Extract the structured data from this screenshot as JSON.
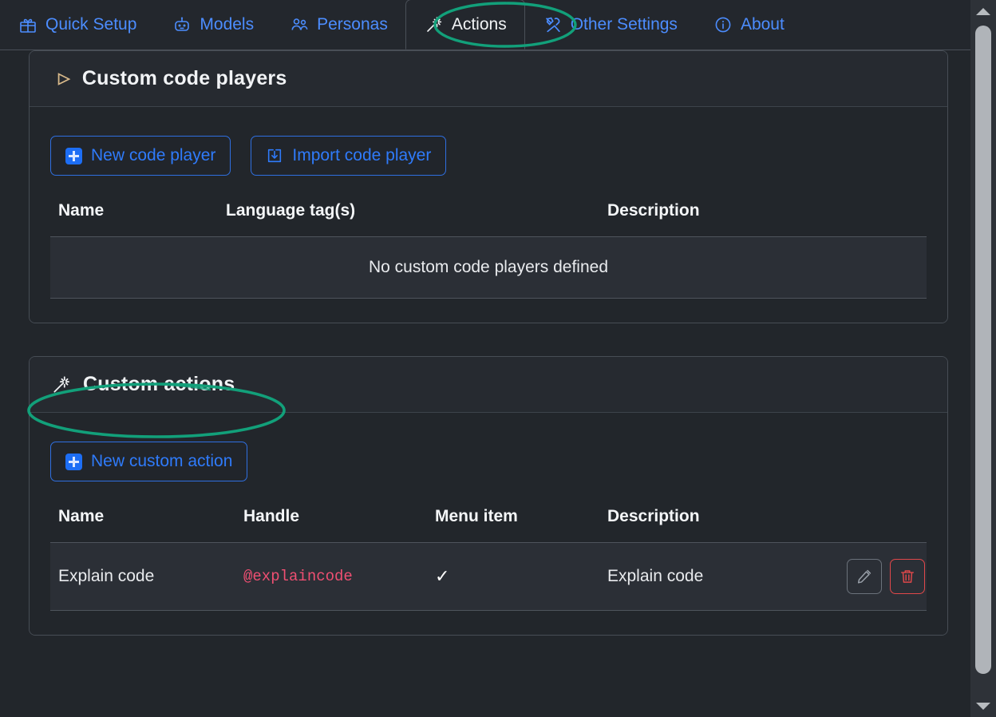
{
  "colors": {
    "accent_blue": "#2f7bfb",
    "annotation_green": "#12a07a",
    "handle_pink": "#ef4f72",
    "danger_red": "#e0484a",
    "panel_bg": "#22262b",
    "card_bg": "#262a30",
    "row_bg": "#2b2f36"
  },
  "tabs": [
    {
      "label": "Quick Setup",
      "icon": "gift-icon",
      "active": false
    },
    {
      "label": "Models",
      "icon": "robot-icon",
      "active": false
    },
    {
      "label": "Personas",
      "icon": "people-icon",
      "active": false
    },
    {
      "label": "Actions",
      "icon": "magic-wand-icon",
      "active": true
    },
    {
      "label": "Other Settings",
      "icon": "tools-icon",
      "active": false
    },
    {
      "label": "About",
      "icon": "info-icon",
      "active": false
    }
  ],
  "code_players": {
    "title": "Custom code players",
    "collapse_icon": "triangle-right-icon",
    "buttons": [
      {
        "label": "New code player",
        "icon": "plus-icon"
      },
      {
        "label": "Import code player",
        "icon": "import-icon"
      }
    ],
    "columns": [
      "Name",
      "Language tag(s)",
      "Description"
    ],
    "empty_message": "No custom code players defined",
    "rows": []
  },
  "custom_actions": {
    "title": "Custom actions",
    "header_icon": "magic-wand-icon",
    "buttons": [
      {
        "label": "New custom action",
        "icon": "plus-icon"
      }
    ],
    "columns": [
      "Name",
      "Handle",
      "Menu item",
      "Description"
    ],
    "rows": [
      {
        "name": "Explain code",
        "handle": "@explaincode",
        "menu_item": "✓",
        "description": "Explain code",
        "edit_label": "edit-icon",
        "delete_label": "trash-icon"
      }
    ]
  },
  "scrollbar": {
    "up_arrow": "scroll-up-arrow",
    "down_arrow": "scroll-down-arrow"
  }
}
